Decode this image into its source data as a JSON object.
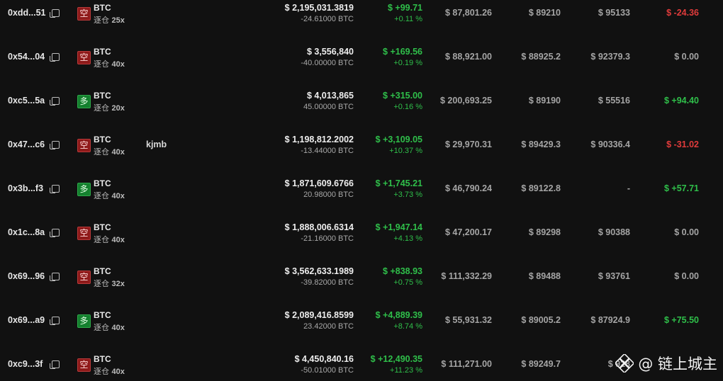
{
  "rows": [
    {
      "addr": "0xdd...51",
      "side_label": "空",
      "side": "short",
      "symbol": "BTC",
      "mode": "逐仓",
      "leverage": "25x",
      "note": "",
      "value": "$ 2,195,031.3819",
      "qty": "-24.61000 BTC",
      "pnl": "$ +99.71",
      "pnl_pct": "+0.11 %",
      "entry": "$ 87,801.26",
      "mark": "$ 89210",
      "liq": "$ 95133",
      "funding": "$ -24.36",
      "funding_sign": "neg"
    },
    {
      "addr": "0x54...04",
      "side_label": "空",
      "side": "short",
      "symbol": "BTC",
      "mode": "逐仓",
      "leverage": "40x",
      "note": "",
      "value": "$ 3,556,840",
      "qty": "-40.00000 BTC",
      "pnl": "$ +169.56",
      "pnl_pct": "+0.19 %",
      "entry": "$ 88,921.00",
      "mark": "$ 88925.2",
      "liq": "$ 92379.3",
      "funding": "$ 0.00",
      "funding_sign": "zero"
    },
    {
      "addr": "0xc5...5a",
      "side_label": "多",
      "side": "long",
      "symbol": "BTC",
      "mode": "逐仓",
      "leverage": "20x",
      "note": "",
      "value": "$ 4,013,865",
      "qty": "45.00000 BTC",
      "pnl": "$ +315.00",
      "pnl_pct": "+0.16 %",
      "entry": "$ 200,693.25",
      "mark": "$ 89190",
      "liq": "$ 55516",
      "funding": "$ +94.40",
      "funding_sign": "pos"
    },
    {
      "addr": "0x47...c6",
      "side_label": "空",
      "side": "short",
      "symbol": "BTC",
      "mode": "逐仓",
      "leverage": "40x",
      "note": "kjmb",
      "value": "$ 1,198,812.2002",
      "qty": "-13.44000 BTC",
      "pnl": "$ +3,109.05",
      "pnl_pct": "+10.37 %",
      "entry": "$ 29,970.31",
      "mark": "$ 89429.3",
      "liq": "$ 90336.4",
      "funding": "$ -31.02",
      "funding_sign": "neg"
    },
    {
      "addr": "0x3b...f3",
      "side_label": "多",
      "side": "long",
      "symbol": "BTC",
      "mode": "逐仓",
      "leverage": "40x",
      "note": "",
      "value": "$ 1,871,609.6766",
      "qty": "20.98000 BTC",
      "pnl": "$ +1,745.21",
      "pnl_pct": "+3.73 %",
      "entry": "$ 46,790.24",
      "mark": "$ 89122.8",
      "liq": "-",
      "funding": "$ +57.71",
      "funding_sign": "pos"
    },
    {
      "addr": "0x1c...8a",
      "side_label": "空",
      "side": "short",
      "symbol": "BTC",
      "mode": "逐仓",
      "leverage": "40x",
      "note": "",
      "value": "$ 1,888,006.6314",
      "qty": "-21.16000 BTC",
      "pnl": "$ +1,947.14",
      "pnl_pct": "+4.13 %",
      "entry": "$ 47,200.17",
      "mark": "$ 89298",
      "liq": "$ 90388",
      "funding": "$ 0.00",
      "funding_sign": "zero"
    },
    {
      "addr": "0x69...96",
      "side_label": "空",
      "side": "short",
      "symbol": "BTC",
      "mode": "逐仓",
      "leverage": "32x",
      "note": "",
      "value": "$ 3,562,633.1989",
      "qty": "-39.82000 BTC",
      "pnl": "$ +838.93",
      "pnl_pct": "+0.75 %",
      "entry": "$ 111,332.29",
      "mark": "$ 89488",
      "liq": "$ 93761",
      "funding": "$ 0.00",
      "funding_sign": "zero"
    },
    {
      "addr": "0x69...a9",
      "side_label": "多",
      "side": "long",
      "symbol": "BTC",
      "mode": "逐仓",
      "leverage": "40x",
      "note": "",
      "value": "$ 2,089,416.8599",
      "qty": "23.42000 BTC",
      "pnl": "$ +4,889.39",
      "pnl_pct": "+8.74 %",
      "entry": "$ 55,931.32",
      "mark": "$ 89005.2",
      "liq": "$ 87924.9",
      "funding": "$ +75.50",
      "funding_sign": "pos"
    },
    {
      "addr": "0xc9...3f",
      "side_label": "空",
      "side": "short",
      "symbol": "BTC",
      "mode": "逐仓",
      "leverage": "40x",
      "note": "",
      "value": "$ 4,450,840.16",
      "qty": "-50.01000 BTC",
      "pnl": "$ +12,490.35",
      "pnl_pct": "+11.23 %",
      "entry": "$ 111,271.00",
      "mark": "$ 89249.7",
      "liq": "$ 928",
      "funding": "",
      "funding_sign": "zero"
    }
  ],
  "watermark": {
    "text": "@ 链上城主",
    "icon": "binance-square-logo"
  },
  "colors": {
    "positive": "#2fbf4a",
    "negative": "#e03b3b",
    "short_badge": "#8e1a1a",
    "long_badge": "#14802e",
    "background": "#111111"
  }
}
